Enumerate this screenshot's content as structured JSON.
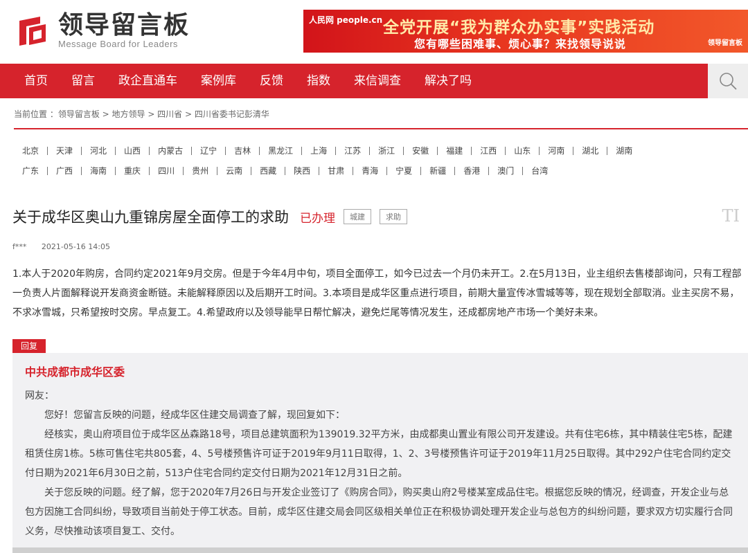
{
  "logo": {
    "cn": "领导留言板",
    "en": "Message Board for Leaders"
  },
  "banner": {
    "source": "人民网 people.cn",
    "headline": "全党开展“我为群众办实事”实践活动",
    "subline": "您有哪些困难事、烦心事？来找领导说说",
    "brand": "领导留言板"
  },
  "nav": [
    "首页",
    "留言",
    "政企直通车",
    "案例库",
    "反馈",
    "指数",
    "来信调查",
    "解决了吗"
  ],
  "breadcrumb": "当前位置 ：领导留言板 > 地方领导 > 四川省 > 四川省委书记彭清华",
  "regions_row1": [
    "北京",
    "天津",
    "河北",
    "山西",
    "内蒙古",
    "辽宁",
    "吉林",
    "黑龙江",
    "上海",
    "江苏",
    "浙江",
    "安徽",
    "福建",
    "江西",
    "山东",
    "河南",
    "湖北",
    "湖南"
  ],
  "regions_row2": [
    "广东",
    "广西",
    "海南",
    "重庆",
    "四川",
    "贵州",
    "云南",
    "西藏",
    "陕西",
    "甘肃",
    "青海",
    "宁夏",
    "新疆",
    "香港",
    "澳门",
    "台湾"
  ],
  "post": {
    "title": "关于成华区奥山九重锦房屋全面停工的求助",
    "status": "已办理",
    "tags": [
      "城建",
      "求助"
    ],
    "font_toggle": "TI",
    "author": "f***",
    "date": "2021-05-16 14:05",
    "body": "1.本人于2020年购房，合同约定2021年9月交房。但是于今年4月中旬，项目全面停工，如今已过去一个月仍未开工。2.在5月13日，业主组织去售楼部询问，只有工程部一负责人片面解释说开发商资金断链。未能解释原因以及后期开工时间。3.本项目是成华区重点进行项目，前期大量宣传冰雪城等等，现在规划全部取消。业主买房不易，不求冰雪城，只希望按时交房。早点复工。4.希望政府以及领导能早日帮忙解决，避免烂尾等情况发生，还成都房地产市场一个美好未来。"
  },
  "reply": {
    "badge": "回复",
    "org": "中共成都市成华区委",
    "greeting": "网友：",
    "p1": "您好！您留言反映的问题，经成华区住建交局调查了解，现回复如下：",
    "p2": "经核实，奥山府项目位于成华区丛森路18号，项目总建筑面积为139019.32平方米，由成都奥山置业有限公司开发建设。共有住宅6栋，其中精装住宅5栋，配建租赁住房1栋。5栋可售住宅共805套，4、5号楼预售许可证于2019年9月11日取得，1、2、3号楼预售许可证于2019年11月25日取得。其中292户住宅合同约定交付日期为2021年6月30日之前，513户住宅合同约定交付日期为2021年12月31日之前。",
    "p3": "关于您反映的问题。经了解，您于2020年7月26日与开发企业签订了《购房合同》，购买奥山府2号楼某室成品住宅。根据您反映的情况，经调查，开发企业与总包方因施工合同纠纷，导致项目当前处于停工状态。目前，成华区住建交局会同区级相关单位正在积极协调处理开发企业与总包方的纠纷问题，要求双方切实履行合同义务，尽快推动该项目复工、交付。"
  },
  "colors": {
    "brand_red": "#d6232c",
    "reply_bg": "#f1f1f3"
  }
}
